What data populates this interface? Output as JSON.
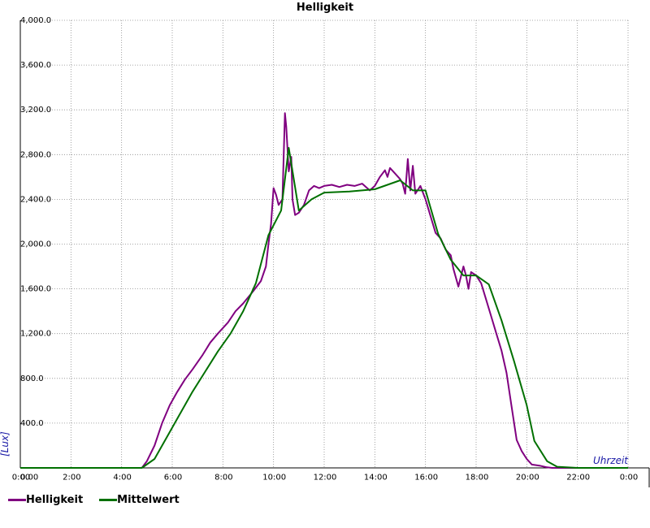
{
  "chart_data": {
    "type": "line",
    "title": "Helligkeit",
    "xlabel": "Uhrzeit",
    "ylabel": "[Lux]",
    "xlim": [
      0,
      24
    ],
    "ylim": [
      0,
      4000
    ],
    "x_tick_labels": [
      "0:00",
      "2:00",
      "4:00",
      "6:00",
      "8:00",
      "10:00",
      "12:00",
      "14:00",
      "16:00",
      "18:00",
      "20:00",
      "22:00",
      "0:00"
    ],
    "y_tick_labels": [
      "4,000.0",
      "3,600.0",
      "3,200.0",
      "2,800.0",
      "2,400.0",
      "2,000.0",
      "1,600.0",
      "1,200.0",
      "800.0",
      "400.0",
      "0.00"
    ],
    "y_tick_values": [
      4000,
      3600,
      3200,
      2800,
      2400,
      2000,
      1600,
      1200,
      800,
      400,
      0
    ],
    "grid": true,
    "legend_position": "bottom-left",
    "series": [
      {
        "name": "Helligkeit",
        "color": "#800080",
        "x": [
          0,
          4.8,
          5.0,
          5.3,
          5.6,
          5.9,
          6.2,
          6.5,
          6.8,
          7.2,
          7.5,
          7.8,
          8.2,
          8.5,
          8.8,
          9.2,
          9.5,
          9.7,
          9.8,
          9.9,
          10.0,
          10.1,
          10.2,
          10.35,
          10.45,
          10.5,
          10.6,
          10.7,
          10.75,
          10.85,
          11.0,
          11.2,
          11.4,
          11.6,
          11.8,
          12.0,
          12.3,
          12.6,
          12.9,
          13.2,
          13.5,
          13.8,
          14.0,
          14.2,
          14.4,
          14.5,
          14.6,
          14.8,
          15.0,
          15.1,
          15.2,
          15.3,
          15.4,
          15.5,
          15.6,
          15.8,
          16.0,
          16.2,
          16.4,
          16.6,
          16.8,
          17.0,
          17.1,
          17.2,
          17.3,
          17.5,
          17.6,
          17.7,
          17.8,
          18.0,
          18.2,
          18.4,
          18.6,
          18.8,
          19.0,
          19.2,
          19.4,
          19.6,
          19.8,
          20.0,
          20.2,
          20.5,
          20.8,
          21.0,
          21.3,
          21.6,
          22.0,
          24.0
        ],
        "y": [
          0,
          0,
          60,
          200,
          400,
          560,
          680,
          790,
          880,
          1010,
          1120,
          1200,
          1300,
          1400,
          1470,
          1580,
          1670,
          1800,
          2000,
          2180,
          2500,
          2440,
          2350,
          2400,
          3170,
          3050,
          2650,
          2780,
          2400,
          2260,
          2280,
          2350,
          2480,
          2520,
          2500,
          2520,
          2530,
          2510,
          2530,
          2520,
          2540,
          2480,
          2520,
          2600,
          2660,
          2600,
          2680,
          2630,
          2580,
          2540,
          2450,
          2760,
          2480,
          2700,
          2450,
          2520,
          2400,
          2250,
          2100,
          2050,
          1950,
          1900,
          1780,
          1700,
          1620,
          1800,
          1720,
          1600,
          1750,
          1720,
          1650,
          1500,
          1350,
          1200,
          1050,
          850,
          550,
          250,
          150,
          80,
          30,
          20,
          5,
          0,
          0,
          0,
          0,
          0
        ]
      },
      {
        "name": "Mittelwert",
        "color": "#007000",
        "x": [
          0,
          4.8,
          5.3,
          5.8,
          6.3,
          6.8,
          7.3,
          7.8,
          8.3,
          8.8,
          9.3,
          9.8,
          10.3,
          10.6,
          11.0,
          11.5,
          12.0,
          13.0,
          14.0,
          15.0,
          15.5,
          16.0,
          16.5,
          17.0,
          17.5,
          18.0,
          18.5,
          19.0,
          19.5,
          20.0,
          20.3,
          20.8,
          21.2,
          22.0,
          24.0
        ],
        "y": [
          0,
          0,
          80,
          280,
          480,
          680,
          860,
          1040,
          1200,
          1400,
          1650,
          2080,
          2300,
          2860,
          2300,
          2400,
          2460,
          2470,
          2490,
          2570,
          2480,
          2480,
          2090,
          1860,
          1720,
          1720,
          1640,
          1320,
          950,
          560,
          240,
          60,
          10,
          0,
          0
        ]
      }
    ]
  }
}
